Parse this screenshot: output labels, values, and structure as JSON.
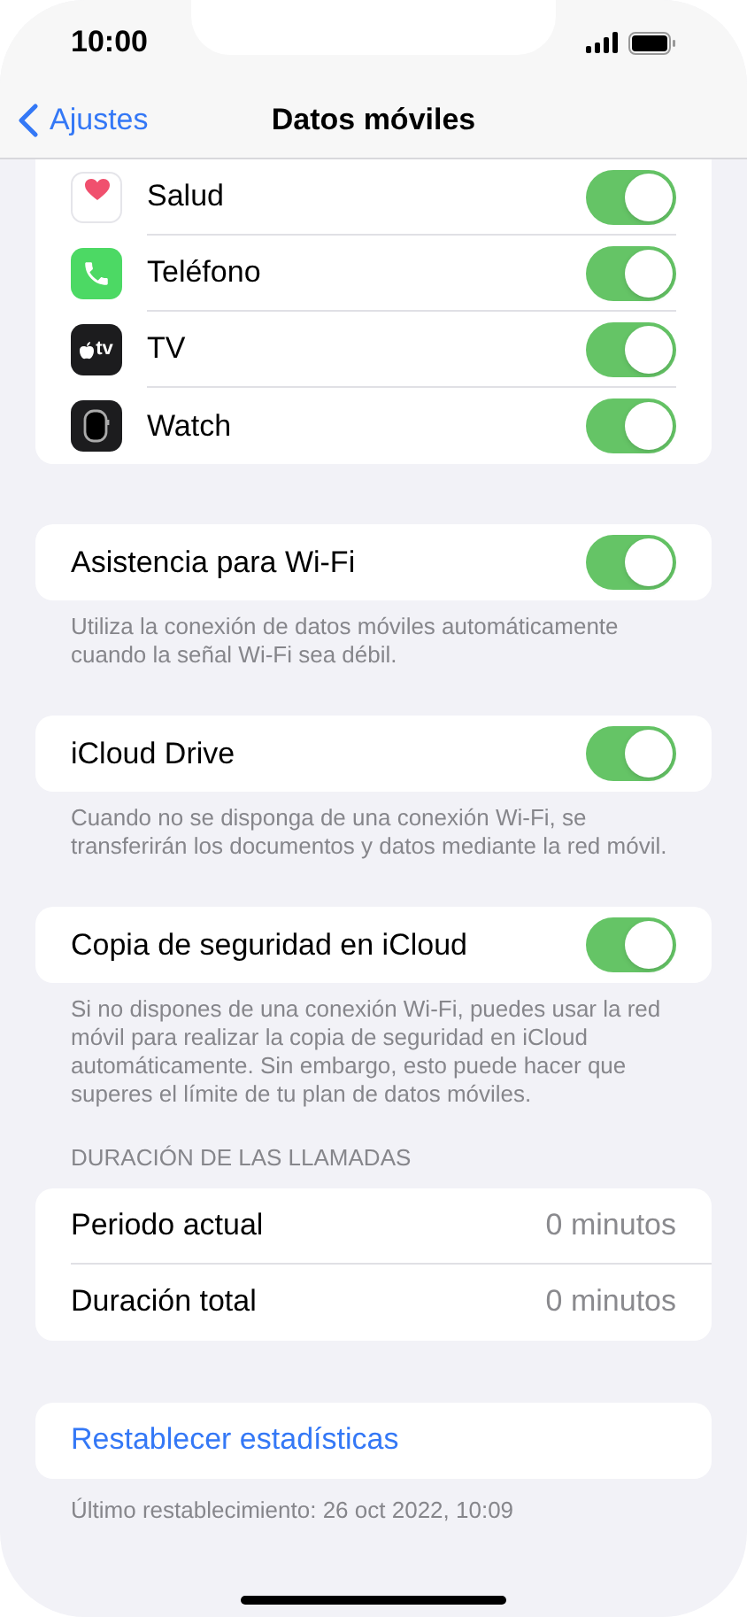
{
  "status_bar": {
    "time": "10:00"
  },
  "nav": {
    "back": "Ajustes",
    "title": "Datos móviles"
  },
  "apps": [
    {
      "kind": "health",
      "label": "Salud",
      "on": true
    },
    {
      "kind": "phone",
      "label": "Teléfono",
      "on": true
    },
    {
      "kind": "tv",
      "label": "TV",
      "on": true,
      "icon_text": "tv"
    },
    {
      "kind": "watch",
      "label": "Watch",
      "on": true
    }
  ],
  "settings": [
    {
      "label": "Asistencia para Wi-Fi",
      "on": true,
      "footer": "Utiliza la conexión de datos móviles automáticamente cuando la señal Wi-Fi sea débil."
    },
    {
      "label": "iCloud Drive",
      "on": true,
      "footer": "Cuando no se disponga de una conexión Wi-Fi, se transferirán los documentos y datos mediante la red móvil."
    },
    {
      "label": "Copia de seguridad en iCloud",
      "on": true,
      "footer": "Si no dispones de una conexión Wi-Fi, puedes usar la red móvil para realizar la copia de seguridad en iCloud automáticamente. Sin embargo, esto puede hacer que superes el límite de tu plan de datos móviles."
    }
  ],
  "call_duration": {
    "header": "DURACIÓN DE LAS LLAMADAS",
    "rows": [
      {
        "label": "Periodo actual",
        "value": "0 minutos"
      },
      {
        "label": "Duración total",
        "value": "0 minutos"
      }
    ]
  },
  "reset": {
    "button": "Restablecer estadísticas",
    "footer": "Último restablecimiento: 26 oct 2022, 10:09"
  }
}
